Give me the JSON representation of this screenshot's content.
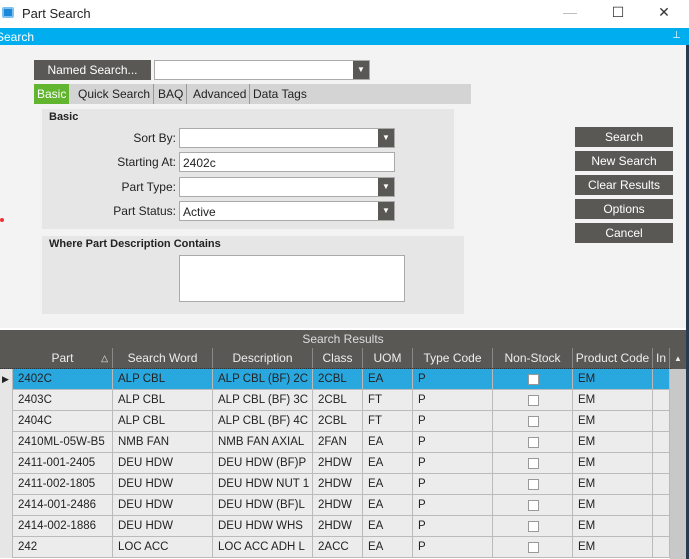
{
  "window": {
    "title": "Part Search",
    "minimize": "—",
    "maximize": "☐",
    "close": "✕"
  },
  "panel": {
    "title": "Search",
    "pin": "⊥"
  },
  "named_search": {
    "label": "Named Search...",
    "value": ""
  },
  "tabs": [
    {
      "label": "Basic",
      "active": true
    },
    {
      "label": "Quick Search"
    },
    {
      "label": "BAQ"
    },
    {
      "label": "Advanced"
    },
    {
      "label": "Data Tags"
    }
  ],
  "basic": {
    "group_title": "Basic",
    "sort_by_label": "Sort By:",
    "sort_by": "",
    "starting_at_label": "Starting At:",
    "starting_at": "2402c",
    "part_type_label": "Part Type:",
    "part_type": "",
    "part_status_label": "Part Status:",
    "part_status": "Active"
  },
  "description_group": {
    "title": "Where Part Description Contains",
    "value": ""
  },
  "buttons": {
    "search": "Search",
    "new_search": "New Search",
    "clear": "Clear Results",
    "options": "Options",
    "cancel": "Cancel"
  },
  "results": {
    "title": "Search Results",
    "columns": [
      "Part",
      "Search Word",
      "Description",
      "Class",
      "UOM",
      "Type Code",
      "Non-Stock",
      "Product Code",
      "In"
    ],
    "rows": [
      [
        "2402C",
        "ALP CBL",
        "ALP CBL (BF) 2C",
        "2CBL",
        "EA",
        "P",
        false,
        "EM"
      ],
      [
        "2403C",
        "ALP CBL",
        "ALP CBL (BF) 3C",
        "2CBL",
        "FT",
        "P",
        false,
        "EM"
      ],
      [
        "2404C",
        "ALP CBL",
        "ALP CBL (BF) 4C",
        "2CBL",
        "FT",
        "P",
        false,
        "EM"
      ],
      [
        "2410ML-05W-B5",
        "NMB FAN",
        "NMB FAN AXIAL",
        "2FAN",
        "EA",
        "P",
        false,
        "EM"
      ],
      [
        "2411-001-2405",
        "DEU HDW",
        "DEU HDW (BF)P",
        "2HDW",
        "EA",
        "P",
        false,
        "EM"
      ],
      [
        "2411-002-1805",
        "DEU HDW",
        "DEU HDW NUT 1",
        "2HDW",
        "EA",
        "P",
        false,
        "EM"
      ],
      [
        "2414-001-2486",
        "DEU HDW",
        "DEU HDW (BF)L",
        "2HDW",
        "EA",
        "P",
        false,
        "EM"
      ],
      [
        "2414-002-1886",
        "DEU HDW",
        "DEU HDW WHS",
        "2HDW",
        "EA",
        "P",
        false,
        "EM"
      ],
      [
        "242",
        "LOC ACC",
        "LOC ACC ADH L",
        "2ACC",
        "EA",
        "P",
        false,
        "EM"
      ]
    ]
  }
}
